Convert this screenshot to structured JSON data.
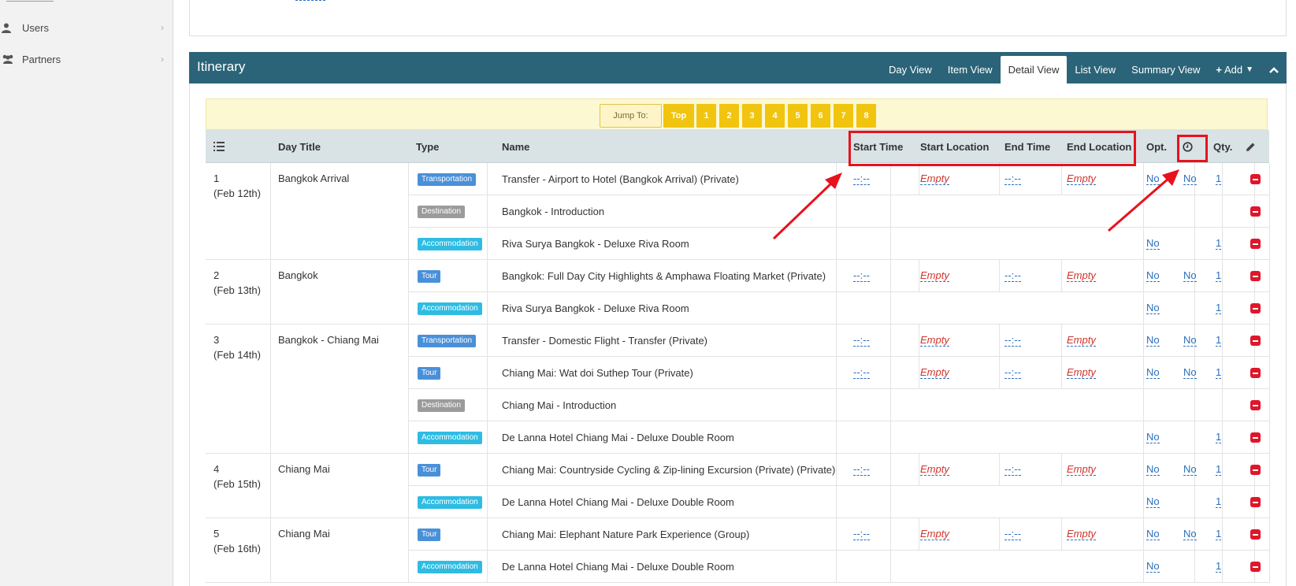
{
  "sidebar": {
    "items": [
      {
        "label": "Users",
        "icon": "user-icon"
      },
      {
        "label": "Partners",
        "icon": "users-group-icon"
      }
    ]
  },
  "itinerary": {
    "title": "Itinerary",
    "tabs": [
      "Day View",
      "Item View",
      "Detail View",
      "List View",
      "Summary View"
    ],
    "active_tab": "Detail View",
    "add_label": "Add"
  },
  "jump": {
    "label": "Jump To:",
    "buttons": [
      "Top",
      "1",
      "2",
      "3",
      "4",
      "5",
      "6",
      "7",
      "8"
    ]
  },
  "columns": {
    "day_title": "Day Title",
    "type": "Type",
    "name": "Name",
    "start_time": "Start Time",
    "start_location": "Start Location",
    "end_time": "End Time",
    "end_location": "End Location",
    "opt": "Opt.",
    "qty": "Qty."
  },
  "days": [
    {
      "num": "1",
      "date": "(Feb 12th)",
      "title": "Bangkok Arrival"
    },
    {
      "num": "2",
      "date": "(Feb 13th)",
      "title": "Bangkok"
    },
    {
      "num": "3",
      "date": "(Feb 14th)",
      "title": "Bangkok - Chiang Mai"
    },
    {
      "num": "4",
      "date": "(Feb 15th)",
      "title": "Chiang Mai"
    },
    {
      "num": "5",
      "date": "(Feb 16th)",
      "title": "Chiang Mai"
    }
  ],
  "rows": [
    {
      "type": "Transportation",
      "name": "Transfer - Airport to Hotel (Bangkok Arrival) (Private)",
      "start_time": "--:--",
      "start_location": "Empty",
      "end_time": "--:--",
      "end_location": "Empty",
      "opt": "No",
      "clock": "No",
      "qty": "1"
    },
    {
      "type": "Destination",
      "name": "Bangkok - Introduction"
    },
    {
      "type": "Accommodation",
      "name": "Riva Surya Bangkok - Deluxe Riva Room",
      "opt": "No",
      "qty": "1"
    },
    {
      "type": "Tour",
      "name": "Bangkok: Full Day City Highlights & Amphawa Floating Market (Private)",
      "start_time": "--:--",
      "start_location": "Empty",
      "end_time": "--:--",
      "end_location": "Empty",
      "opt": "No",
      "clock": "No",
      "qty": "1"
    },
    {
      "type": "Accommodation",
      "name": "Riva Surya Bangkok - Deluxe Riva Room",
      "opt": "No",
      "qty": "1"
    },
    {
      "type": "Transportation",
      "name": "Transfer - Domestic Flight - Transfer (Private)",
      "start_time": "--:--",
      "start_location": "Empty",
      "end_time": "--:--",
      "end_location": "Empty",
      "opt": "No",
      "clock": "No",
      "qty": "1"
    },
    {
      "type": "Tour",
      "name": "Chiang Mai: Wat doi Suthep Tour (Private)",
      "start_time": "--:--",
      "start_location": "Empty",
      "end_time": "--:--",
      "end_location": "Empty",
      "opt": "No",
      "clock": "No",
      "qty": "1"
    },
    {
      "type": "Destination",
      "name": "Chiang Mai - Introduction"
    },
    {
      "type": "Accommodation",
      "name": "De Lanna Hotel Chiang Mai - Deluxe Double Room",
      "opt": "No",
      "qty": "1"
    },
    {
      "type": "Tour",
      "name": "Chiang Mai: Countryside Cycling & Zip-lining Excursion (Private) (Private)",
      "start_time": "--:--",
      "start_location": "Empty",
      "end_time": "--:--",
      "end_location": "Empty",
      "opt": "No",
      "clock": "No",
      "qty": "1"
    },
    {
      "type": "Accommodation",
      "name": "De Lanna Hotel Chiang Mai - Deluxe Double Room",
      "opt": "No",
      "qty": "1"
    },
    {
      "type": "Tour",
      "name": "Chiang Mai: Elephant Nature Park Experience (Group)",
      "start_time": "--:--",
      "start_location": "Empty",
      "end_time": "--:--",
      "end_location": "Empty",
      "opt": "No",
      "clock": "No",
      "qty": "1"
    },
    {
      "type": "Accommodation",
      "name": "De Lanna Hotel Chiang Mai - Deluxe Double Room",
      "opt": "No",
      "qty": "1"
    }
  ],
  "colors": {
    "header_bg": "#2b6478",
    "jump_button": "#f1c40f",
    "annotation_red": "#e8121c"
  }
}
